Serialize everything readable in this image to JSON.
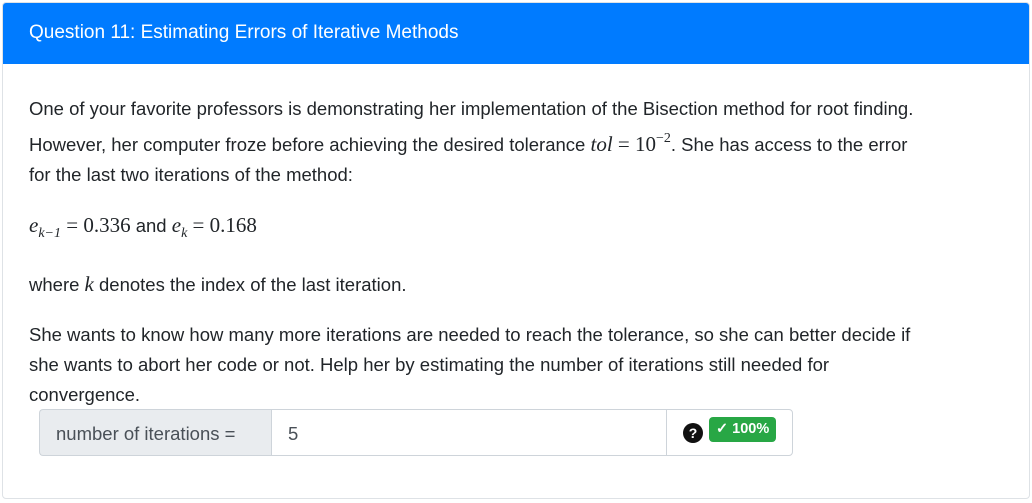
{
  "header": {
    "title": "Question 11: Estimating Errors of Iterative Methods"
  },
  "body": {
    "p1_a": "One of your favorite professors is demonstrating her implementation of the Bisection method for root finding.",
    "p1_b1": "However, her computer froze before achieving the desired tolerance ",
    "tol_var": "tol",
    "tol_eq": " = 10",
    "tol_exp": "−2",
    "p1_b2": ". She has access to the error",
    "p1_c": "for the last two iterations of the method:",
    "e_var": "e",
    "e1_sub": "k−1",
    "e1_val": " = 0.336",
    "and_text": " and ",
    "e2_sub": "k",
    "e2_val": " = 0.168",
    "p3_a": "where ",
    "k_var": "k",
    "p3_b": " denotes the index of the last iteration.",
    "p4_a": "She wants to know how many more iterations are needed to reach the tolerance, so she can better decide if",
    "p4_b": "she wants to abort her code or not. Help her by estimating the number of iterations still needed for",
    "p4_c": "convergence."
  },
  "answer": {
    "label": "number of iterations =",
    "value": "5",
    "help_icon": "question-circle-icon",
    "badge": "✓ 100%"
  },
  "colors": {
    "header_bg": "#007bff",
    "badge_bg": "#28a745"
  }
}
